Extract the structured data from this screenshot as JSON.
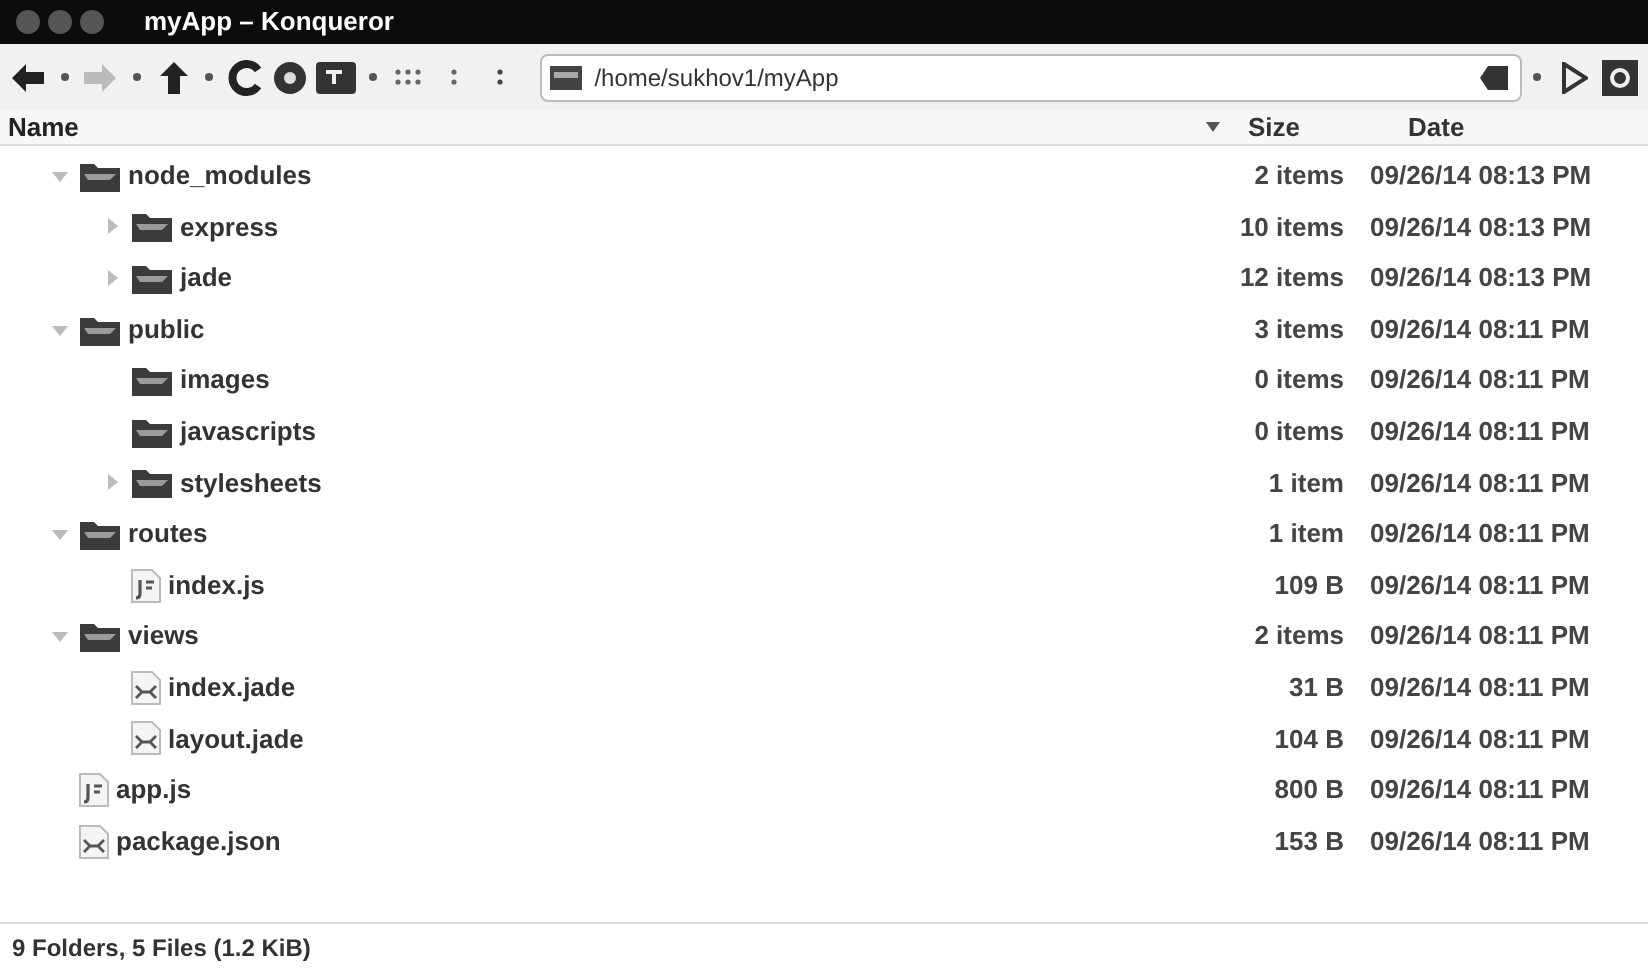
{
  "window": {
    "title": "myApp – Konqueror"
  },
  "location": {
    "value": "/home/sukhov1/myApp"
  },
  "columns": [
    {
      "label": "Name",
      "sorted": true
    },
    {
      "label": "Size",
      "sorted": false
    },
    {
      "label": "Date",
      "sorted": false
    }
  ],
  "tree": [
    {
      "name": "node_modules",
      "kind": "folder",
      "expanded": true,
      "size": "2 items",
      "date": "09/26/14 08:13 PM",
      "children": [
        {
          "name": "express",
          "kind": "folder",
          "expanded": false,
          "size": "10 items",
          "date": "09/26/14 08:13 PM"
        },
        {
          "name": "jade",
          "kind": "folder",
          "expanded": false,
          "size": "12 items",
          "date": "09/26/14 08:13 PM"
        }
      ]
    },
    {
      "name": "public",
      "kind": "folder",
      "expanded": true,
      "size": "3 items",
      "date": "09/26/14 08:11 PM",
      "children": [
        {
          "name": "images",
          "kind": "folder",
          "size": "0 items",
          "date": "09/26/14 08:11 PM"
        },
        {
          "name": "javascripts",
          "kind": "folder",
          "size": "0 items",
          "date": "09/26/14 08:11 PM"
        },
        {
          "name": "stylesheets",
          "kind": "folder",
          "expanded": false,
          "size": "1 item",
          "date": "09/26/14 08:11 PM"
        }
      ]
    },
    {
      "name": "routes",
      "kind": "folder",
      "expanded": true,
      "size": "1 item",
      "date": "09/26/14 08:11 PM",
      "children": [
        {
          "name": "index.js",
          "kind": "script",
          "size": "109 B",
          "date": "09/26/14 08:11 PM"
        }
      ]
    },
    {
      "name": "views",
      "kind": "folder",
      "expanded": true,
      "size": "2 items",
      "date": "09/26/14 08:11 PM",
      "children": [
        {
          "name": "index.jade",
          "kind": "document",
          "size": "31 B",
          "date": "09/26/14 08:11 PM"
        },
        {
          "name": "layout.jade",
          "kind": "document",
          "size": "104 B",
          "date": "09/26/14 08:11 PM"
        }
      ]
    },
    {
      "name": "app.js",
      "kind": "script",
      "size": "800 B",
      "date": "09/26/14 08:11 PM"
    },
    {
      "name": "package.json",
      "kind": "document",
      "size": "153 B",
      "date": "09/26/14 08:11 PM"
    }
  ],
  "status_bar": "9 Folders, 5 Files (1.2 KiB)"
}
